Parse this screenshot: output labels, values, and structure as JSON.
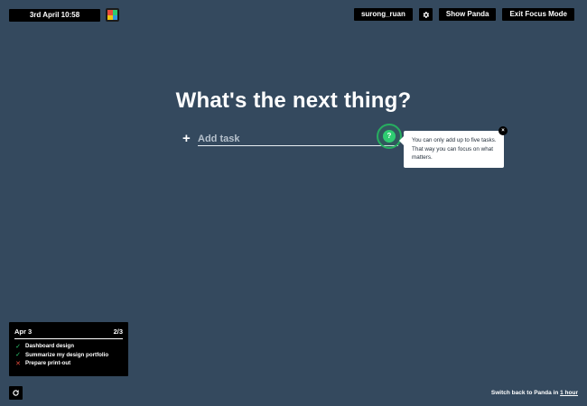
{
  "header": {
    "datetime": "3rd April 10:58",
    "username": "surong_ruan",
    "show_panda_label": "Show Panda",
    "exit_focus_label": "Exit Focus Mode",
    "settings_icon": "gear-icon",
    "logo_colors": [
      "#e74c3c",
      "#2ecc71",
      "#f1c40f",
      "#3498db"
    ]
  },
  "main": {
    "heading": "What's the next thing?",
    "add_task_placeholder": "Add task",
    "add_icon": "plus-icon",
    "help_icon_label": "?",
    "tooltip_text": "You can only add up to five tasks. That way you can focus on what matters.",
    "tooltip_close": "×"
  },
  "summary": {
    "date": "Apr 3",
    "progress": "2/3",
    "items": [
      {
        "label": "Dashboard design",
        "status": "done",
        "icon": "✓"
      },
      {
        "label": "Summarize my design portfolio",
        "status": "done",
        "icon": "✓"
      },
      {
        "label": "Prepare print-out",
        "status": "open",
        "icon": "✕"
      }
    ]
  },
  "footer": {
    "switch_text": "Switch back to Panda in ",
    "switch_link": "1 hour"
  },
  "colors": {
    "background": "#34495e",
    "accent_green": "#2ecc71",
    "fail_red": "#e74c3c"
  }
}
